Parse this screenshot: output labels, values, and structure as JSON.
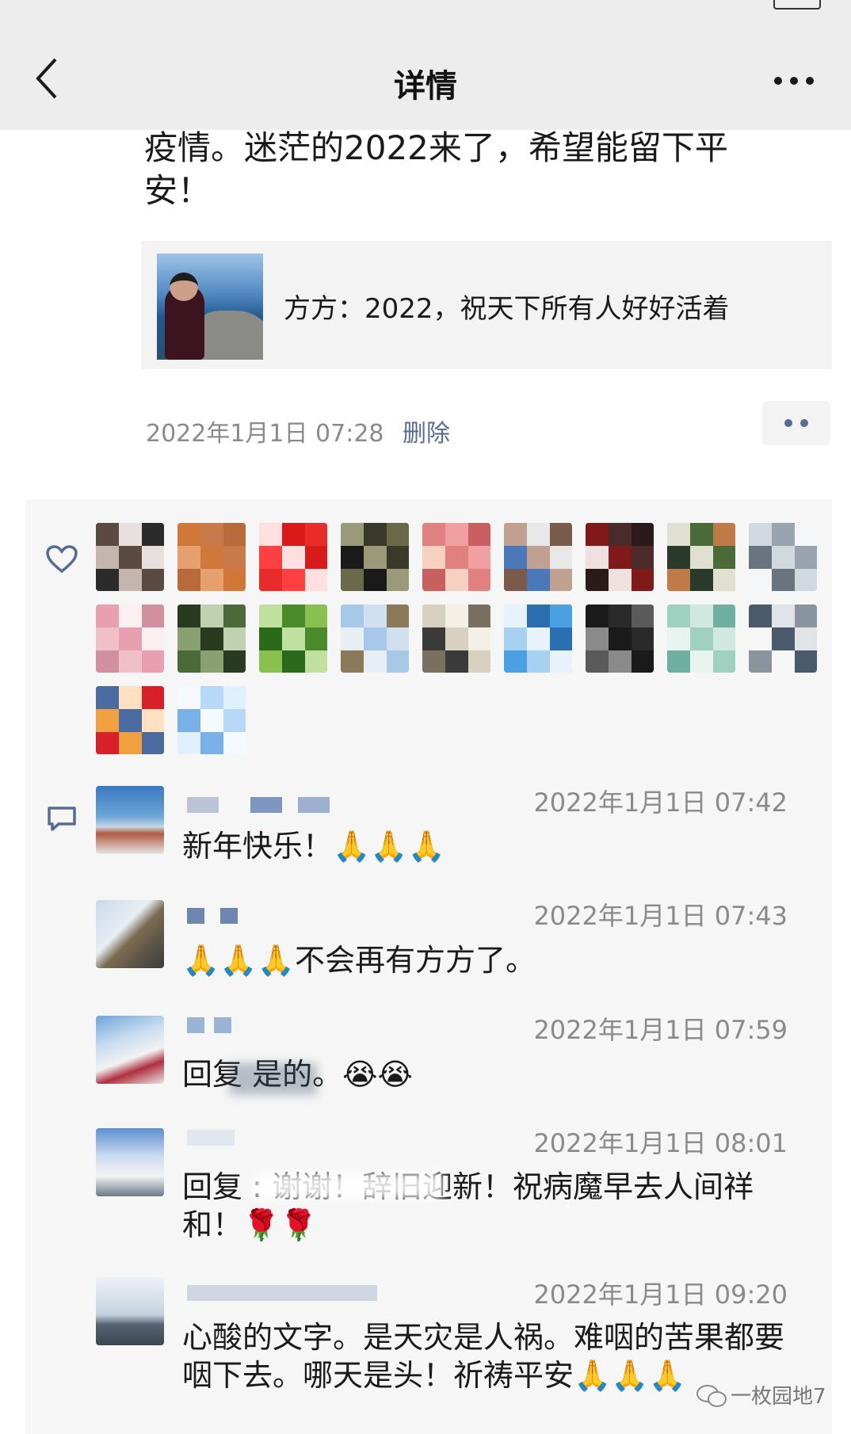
{
  "nav": {
    "title": "详情"
  },
  "post": {
    "text": "疫情。迷茫的2022来了，希望能留下平安！",
    "share_card": {
      "text": "方方：2022，祝天下所有人好好活着"
    },
    "time": "2022年1月1日 07:28",
    "delete_label": "删除"
  },
  "comments": [
    {
      "time": "2022年1月1日 07:42",
      "text": "新年快乐！🙏🙏🙏"
    },
    {
      "time": "2022年1月1日 07:43",
      "text": "🙏🙏🙏不会再有方方了。"
    },
    {
      "time": "2022年1月1日 07:59",
      "text": "回复        是的。😭😭"
    },
    {
      "time": "2022年1月1日 08:01",
      "text": "回复              : 谢谢！辞旧迎新！祝病魔早去人间祥和！🌹🌹"
    },
    {
      "time": "2022年1月1日 09:20",
      "text": "心酸的文字。是天灾是人祸。难咽的苦果都要咽下去。哪天是头！祈祷平安🙏🙏🙏"
    }
  ],
  "watermark": "一枚园地7",
  "colors": {
    "link": "#576b95",
    "nav_bg": "#ededed",
    "box_bg": "#f6f6f6"
  },
  "icons": [
    "back-chevron-icon",
    "more-icon",
    "heart-icon",
    "comment-icon",
    "wechat-logo-icon"
  ]
}
